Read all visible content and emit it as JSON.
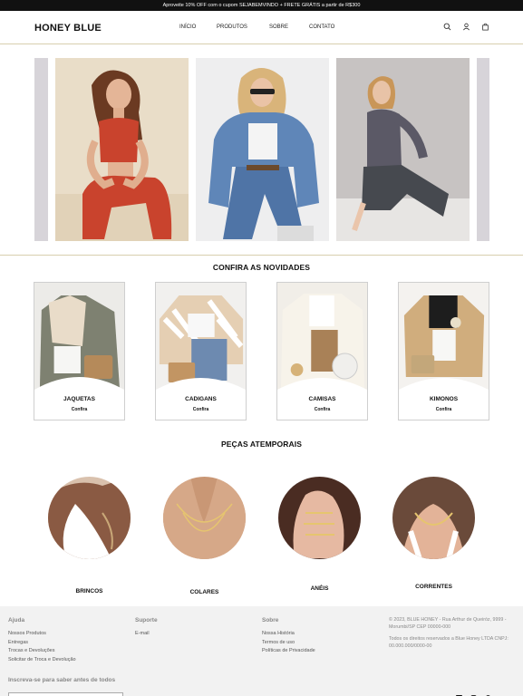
{
  "promo": {
    "text": "Aproveite 10% OFF com o cupom SEJABEMVINDO + FRETE GRÁTIS a partir de R$300"
  },
  "header": {
    "logo": "HONEY BLUE",
    "nav": [
      "INÍCIO",
      "PRODUTOS",
      "SOBRE",
      "CONTATO"
    ],
    "icons": [
      "search-icon",
      "user-icon",
      "bag-icon"
    ]
  },
  "banner": {
    "slides": [
      "model-red-outfit",
      "model-denim-jacket",
      "model-grey-sweater"
    ]
  },
  "novidades": {
    "title": "CONFIRA AS NOVIDADES",
    "items": [
      {
        "name": "JAQUETAS",
        "cta": "Confira"
      },
      {
        "name": "CADIGANS",
        "cta": "Confira"
      },
      {
        "name": "CAMISAS",
        "cta": "Confira"
      },
      {
        "name": "KIMONOS",
        "cta": "Confira"
      }
    ]
  },
  "atemporais": {
    "title": "PEÇAS ATEMPORAIS",
    "items": [
      "BRINCOS",
      "COLARES",
      "ANÉIS",
      "CORRENTES"
    ]
  },
  "footer": {
    "ajuda": {
      "title": "Ajuda",
      "links": [
        "Nossos Produtos",
        "Entregas",
        "Trocas e Devoluções",
        "Solicitar de Troca e Devolução"
      ]
    },
    "suporte": {
      "title": "Suporte",
      "links": [
        "E-mail"
      ]
    },
    "sobre": {
      "title": "Sobre",
      "links": [
        "Nossa História",
        "Termos de uso",
        "Políticas de Privacidade"
      ]
    },
    "address": "© 2023, BLUE HONEY - Rua Arthur de Queiróz, 9999 - Morumbi/SP CEP 00000-000",
    "rights": "Todos os direitos reservados a Blue Honey LTDA CNPJ: 00.000.000/0000-00",
    "newsletter": "Inscreva-se para saber antes de todos",
    "social": [
      "facebook-icon",
      "instagram-icon",
      "pinterest-icon",
      "youtube-icon"
    ]
  },
  "colors": {
    "accent": "#d8cfae",
    "footer_bg": "#f2f2f2",
    "promo_bg": "#111111"
  }
}
